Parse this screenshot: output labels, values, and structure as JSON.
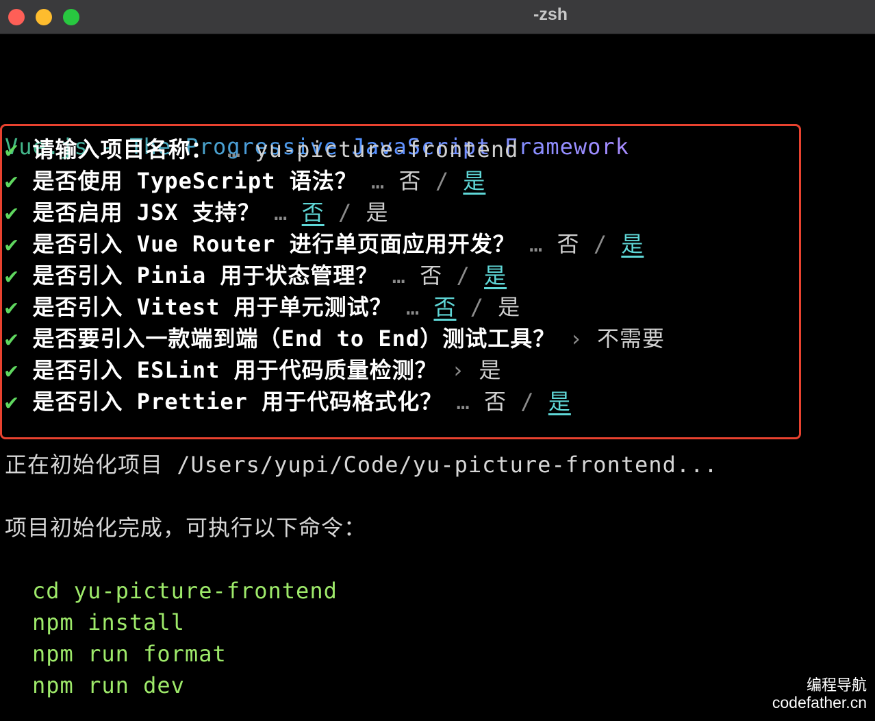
{
  "window": {
    "title": "-zsh"
  },
  "banner": {
    "text": "Vue.js - The Progressive JavaScript Framework",
    "gradient": [
      "#42b883",
      "#4f92ff",
      "#a88cff"
    ]
  },
  "prompts": [
    {
      "check": "✔",
      "question": "请输入项目名称：",
      "sep": " … ",
      "value": "yu-picture-frontend"
    },
    {
      "check": "✔",
      "question": "是否使用 TypeScript 语法？",
      "sep": " … ",
      "no": "否",
      "slash": " / ",
      "yes": "是",
      "selected": "yes"
    },
    {
      "check": "✔",
      "question": "是否启用 JSX 支持？",
      "sep": " … ",
      "no": "否",
      "slash": " / ",
      "yes": "是",
      "selected": "no"
    },
    {
      "check": "✔",
      "question": "是否引入 Vue Router 进行单页面应用开发？",
      "sep": " … ",
      "no": "否",
      "slash": " / ",
      "yes": "是",
      "selected": "yes"
    },
    {
      "check": "✔",
      "question": "是否引入 Pinia 用于状态管理？",
      "sep": " … ",
      "no": "否",
      "slash": " / ",
      "yes": "是",
      "selected": "yes"
    },
    {
      "check": "✔",
      "question": "是否引入 Vitest 用于单元测试？",
      "sep": " … ",
      "no": "否",
      "slash": " / ",
      "yes": "是",
      "selected": "no"
    },
    {
      "check": "✔",
      "question": "是否要引入一款端到端（End to End）测试工具？",
      "sep": " › ",
      "value": "不需要"
    },
    {
      "check": "✔",
      "question": "是否引入 ESLint 用于代码质量检测？",
      "sep": " › ",
      "value": "是"
    },
    {
      "check": "✔",
      "question": "是否引入 Prettier 用于代码格式化？",
      "sep": " … ",
      "no": "否",
      "slash": " / ",
      "yes": "是",
      "selected": "yes"
    }
  ],
  "output": {
    "init_line": "正在初始化项目 /Users/yupi/Code/yu-picture-frontend...",
    "done_line": "项目初始化完成，可执行以下命令：",
    "commands": [
      "cd yu-picture-frontend",
      "npm install",
      "npm run format",
      "npm run dev"
    ]
  },
  "watermark": {
    "line1": "编程导航",
    "line2": "codefather.cn"
  },
  "colors": {
    "highlight_box": "#e8422f",
    "check": "#5fd75f",
    "selected_option": "#5fd7d7",
    "command": "#9eea6a"
  }
}
